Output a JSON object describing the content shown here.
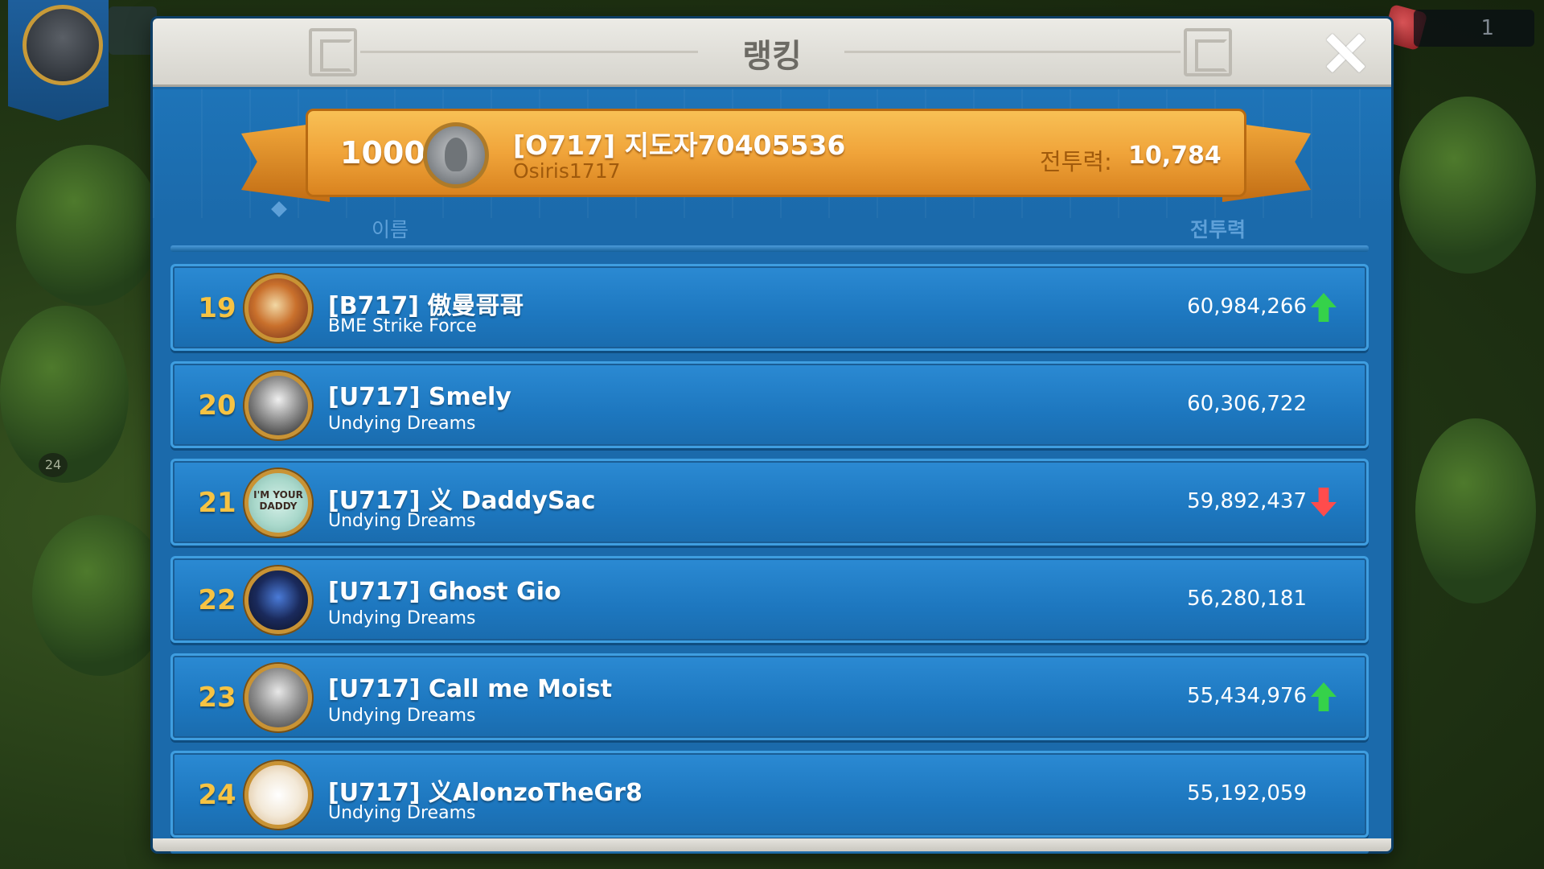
{
  "background": {
    "hud_counter": "1",
    "level_badge": "24"
  },
  "modal": {
    "title": "랭킹",
    "close_icon": "close-icon"
  },
  "player": {
    "rank": "1000+",
    "name": "[O717] 지도자70405536",
    "alliance": "Osiris1717",
    "power_label": "전투력:",
    "power_value": "10,784"
  },
  "columns": {
    "name": "이름",
    "power": "전투력"
  },
  "rankings": [
    {
      "rank": "19",
      "name": "[B717] 傲曼哥哥",
      "alliance": "BME Strike Force",
      "power": "60,984,266",
      "trend": "up"
    },
    {
      "rank": "20",
      "name": "[U717] Smely",
      "alliance": "Undying Dreams",
      "power": "60,306,722",
      "trend": "none"
    },
    {
      "rank": "21",
      "name": "[U717] 义 DaddySac",
      "alliance": "Undying Dreams",
      "power": "59,892,437",
      "trend": "down"
    },
    {
      "rank": "22",
      "name": "[U717] Ghost Gio",
      "alliance": "Undying Dreams",
      "power": "56,280,181",
      "trend": "none"
    },
    {
      "rank": "23",
      "name": "[U717] Call me Moist",
      "alliance": "Undying Dreams",
      "power": "55,434,976",
      "trend": "up"
    },
    {
      "rank": "24",
      "name": "[U717] 义AlonzoTheGr8",
      "alliance": "Undying Dreams",
      "power": "55,192,059",
      "trend": "none"
    }
  ],
  "avatar_text_21": "I'M YOUR DADDY",
  "colors": {
    "panel_blue": "#1b6aab",
    "rank_gold": "#f6c343",
    "banner_orange": "#f0a43a",
    "trend_up": "#35d24a",
    "trend_down": "#ff4c4c"
  }
}
